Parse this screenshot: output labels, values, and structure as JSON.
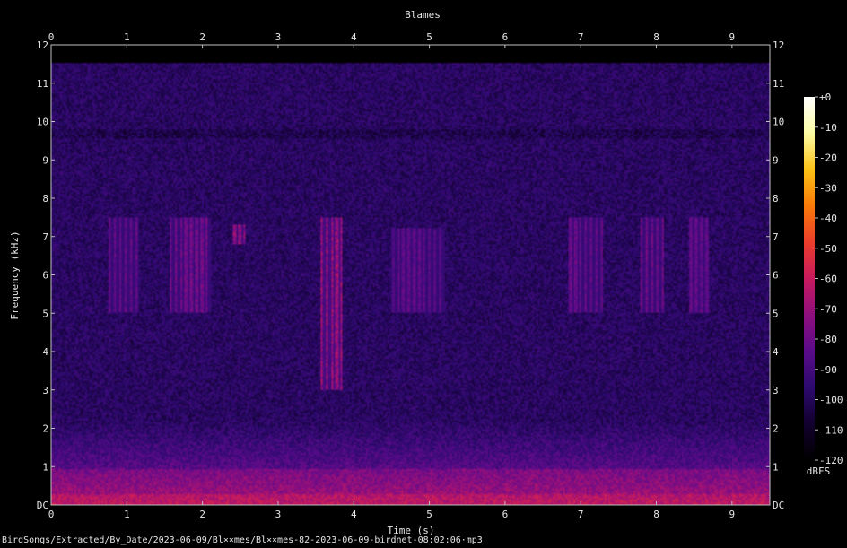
{
  "chart_data": {
    "type": "heatmap",
    "title": "Blames",
    "xlabel": "Time (s)",
    "ylabel": "Frequency (kHz)",
    "xlim": [
      0,
      9.5
    ],
    "ylim": [
      0,
      12
    ],
    "x_ticks": [
      "0",
      "1",
      "2",
      "3",
      "4",
      "5",
      "6",
      "7",
      "8",
      "9"
    ],
    "y_ticks": [
      "DC",
      "1",
      "2",
      "3",
      "4",
      "5",
      "6",
      "7",
      "8",
      "9",
      "10",
      "11",
      "12"
    ],
    "colorbar": {
      "label": "dBFS",
      "ticks": [
        "+0",
        "-10",
        "-20",
        "-30",
        "-40",
        "-50",
        "-60",
        "-70",
        "-80",
        "-90",
        "-100",
        "-110",
        "-120"
      ],
      "range": [
        -120,
        0
      ]
    },
    "colormap": [
      "#000000",
      "#12002e",
      "#2c0a6e",
      "#5a0b8a",
      "#8f0f7e",
      "#c81a5e",
      "#ec3d2b",
      "#f97a08",
      "#fbc216",
      "#fcfca4",
      "#ffffff"
    ],
    "features": [
      {
        "label": "call",
        "t_start": 3.55,
        "t_end": 3.85,
        "f_low": 3.0,
        "f_high": 7.5,
        "level_db": -68
      },
      {
        "label": "call",
        "t_start": 0.75,
        "t_end": 1.15,
        "f_low": 5.0,
        "f_high": 7.5,
        "level_db": -80
      },
      {
        "label": "call",
        "t_start": 1.55,
        "t_end": 2.1,
        "f_low": 5.0,
        "f_high": 7.5,
        "level_db": -78
      },
      {
        "label": "call",
        "t_start": 2.4,
        "t_end": 2.55,
        "f_low": 6.8,
        "f_high": 7.3,
        "level_db": -72
      },
      {
        "label": "call",
        "t_start": 4.5,
        "t_end": 5.2,
        "f_low": 5.0,
        "f_high": 7.2,
        "level_db": -82
      },
      {
        "label": "call",
        "t_start": 6.85,
        "t_end": 7.3,
        "f_low": 5.0,
        "f_high": 7.5,
        "level_db": -80
      },
      {
        "label": "call",
        "t_start": 7.8,
        "t_end": 8.1,
        "f_low": 5.0,
        "f_high": 7.5,
        "level_db": -78
      },
      {
        "label": "call",
        "t_start": 8.45,
        "t_end": 8.7,
        "f_low": 5.0,
        "f_high": 7.5,
        "level_db": -82
      }
    ]
  },
  "footer_text": "BirdSongs/Extracted/By_Date/2023-06-09/Bl××mes/Bl××mes-82-2023-06-09-birdnet-08:02:06·mp3"
}
